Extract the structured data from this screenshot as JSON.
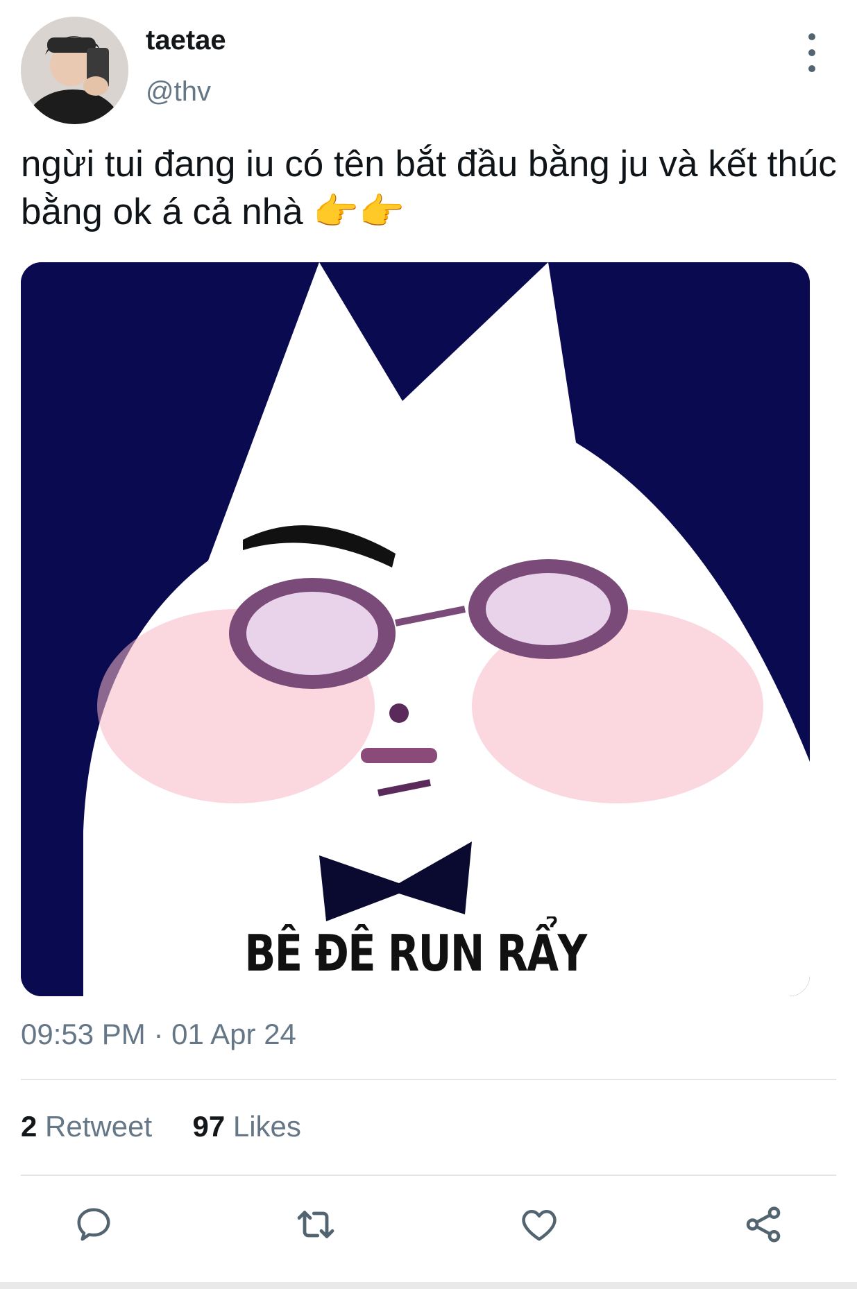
{
  "author": {
    "display_name": "taetae",
    "handle": "@thv"
  },
  "tweet": {
    "text": "ngừi tui đang iu có tên bắt đầu bằng ju và kết thúc bằng ok á cả nhà 👉👉",
    "timestamp": "09:53 PM · 01 Apr 24",
    "media": {
      "caption": "BÊ ĐÊ RUN RẨY"
    }
  },
  "stats": {
    "retweet_count": "2",
    "retweet_label": "Retweet",
    "likes_count": "97",
    "likes_label": "Likes"
  },
  "actions": {
    "icons": [
      "reply-icon",
      "retweet-icon",
      "like-icon",
      "share-icon"
    ]
  },
  "colors": {
    "secondary_text": "#657786",
    "icon": "#536471",
    "divider": "#e1e6ea",
    "media_background": "#0a0a50"
  }
}
